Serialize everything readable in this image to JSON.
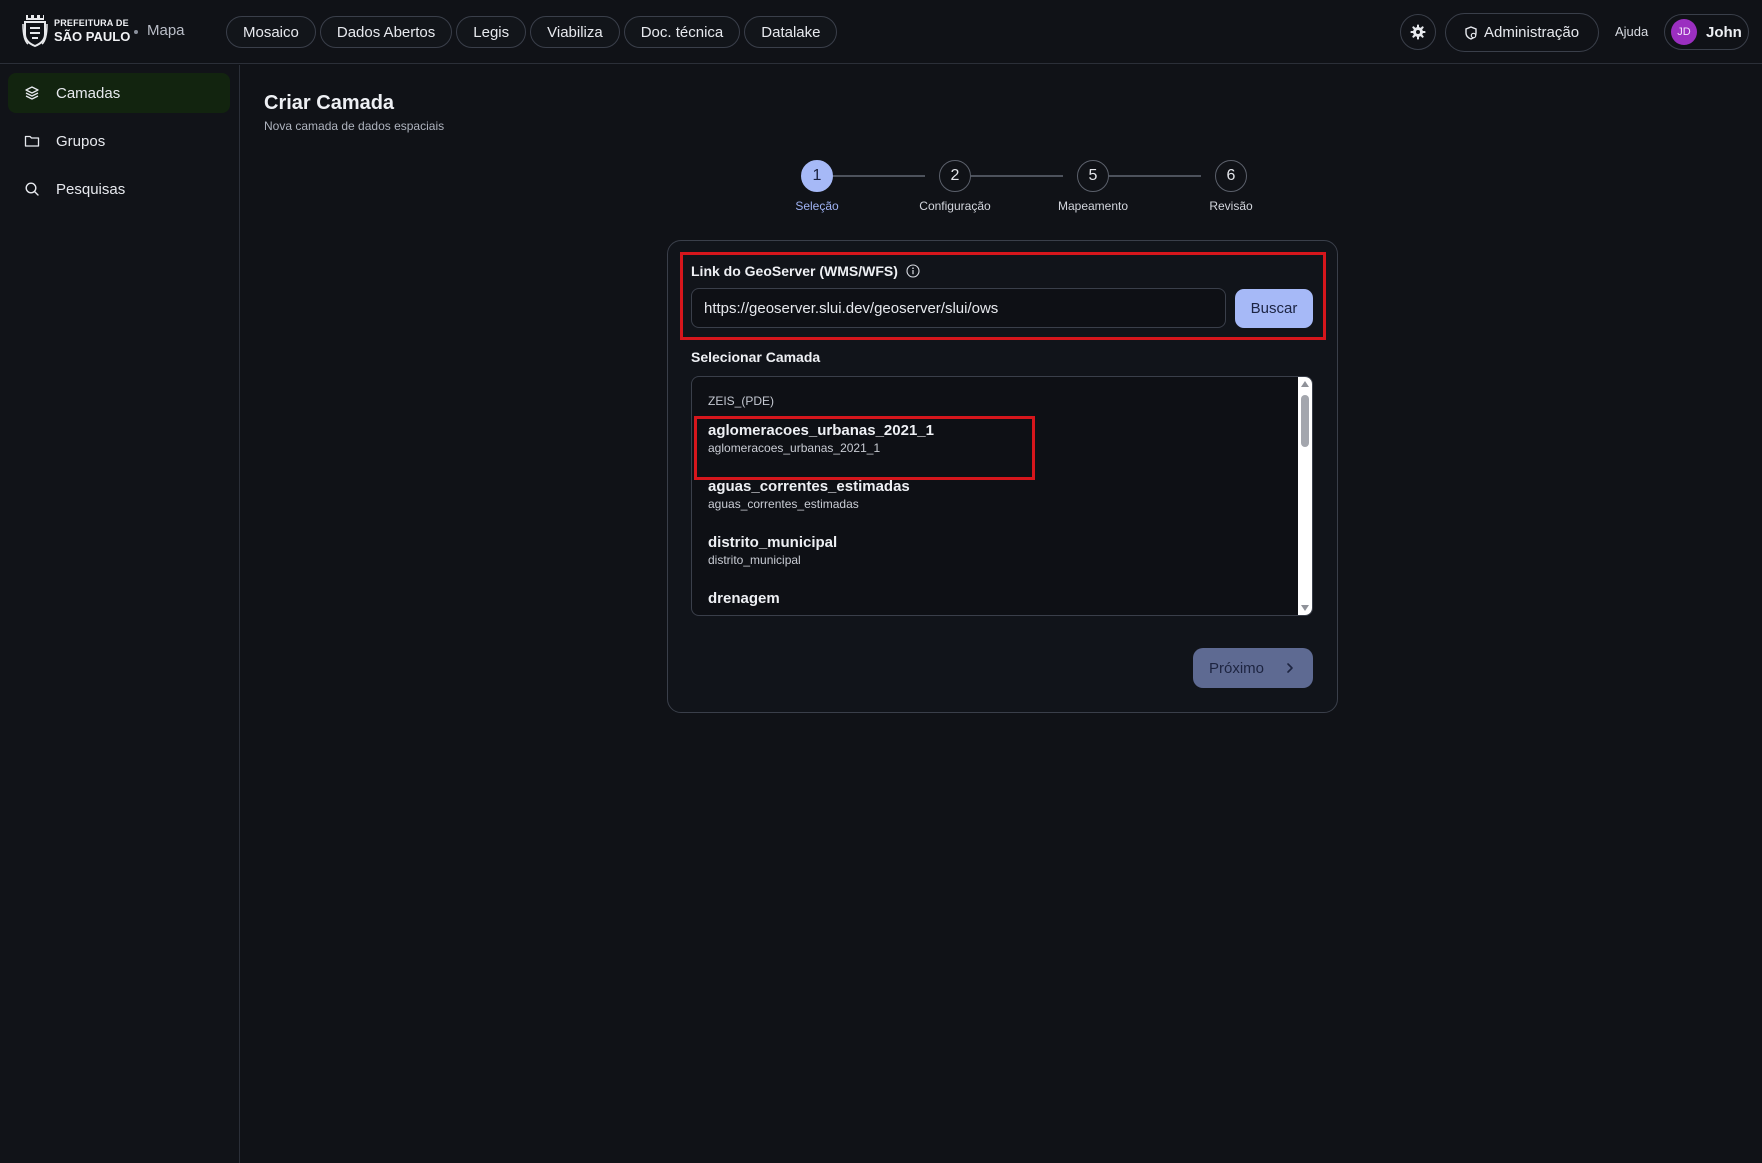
{
  "brand": {
    "line1": "PREFEITURA DE",
    "line2": "SÃO PAULO",
    "app": "Mapa"
  },
  "nav": [
    "Mosaico",
    "Dados Abertos",
    "Legis",
    "Viabiliza",
    "Doc. técnica",
    "Datalake"
  ],
  "header": {
    "admin_label": "Administração",
    "help_label": "Ajuda",
    "user_initials": "JD",
    "user_name": "John"
  },
  "sidebar": {
    "items": [
      {
        "label": "Camadas",
        "icon": "layers-icon",
        "active": true
      },
      {
        "label": "Grupos",
        "icon": "folder-icon",
        "active": false
      },
      {
        "label": "Pesquisas",
        "icon": "search-icon",
        "active": false
      }
    ]
  },
  "page": {
    "title": "Criar Camada",
    "subtitle": "Nova camada de dados espaciais"
  },
  "stepper": {
    "steps": [
      {
        "number": "1",
        "label": "Seleção",
        "active": true
      },
      {
        "number": "2",
        "label": "Configuração",
        "active": false
      },
      {
        "number": "5",
        "label": "Mapeamento",
        "active": false
      },
      {
        "number": "6",
        "label": "Revisão",
        "active": false
      }
    ]
  },
  "form": {
    "url_label": "Link do GeoServer (WMS/WFS)",
    "url_value": "https://geoserver.slui.dev/geoserver/slui/ows",
    "search_button": "Buscar",
    "select_label": "Selecionar Camada",
    "group_name": "ZEIS_(PDE)",
    "layers": [
      {
        "title": "aglomeracoes_urbanas_2021_1",
        "name": "aglomeracoes_urbanas_2021_1"
      },
      {
        "title": "aguas_correntes_estimadas",
        "name": "aguas_correntes_estimadas"
      },
      {
        "title": "distrito_municipal",
        "name": "distrito_municipal"
      },
      {
        "title": "drenagem",
        "name": ""
      }
    ],
    "next_button": "Próximo"
  },
  "colors": {
    "accent": "#a6b9f7",
    "highlight": "#d6161c",
    "active_nav": "#12240f",
    "avatar": "#9b2fc0"
  }
}
